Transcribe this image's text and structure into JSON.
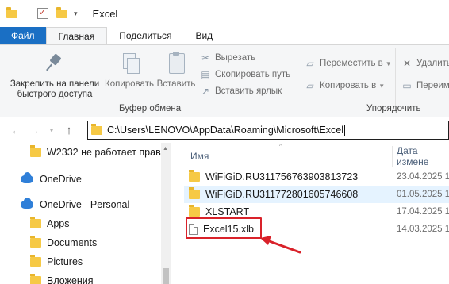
{
  "titlebar": {
    "title": "Excel"
  },
  "ribbon_tabs": [
    {
      "label": "Файл"
    },
    {
      "label": "Главная"
    },
    {
      "label": "Поделиться"
    },
    {
      "label": "Вид"
    }
  ],
  "ribbon": {
    "pin_label_line1": "Закрепить на панели",
    "pin_label_line2": "быстрого доступа",
    "copy_label": "Копировать",
    "paste_label": "Вставить",
    "cut_label": "Вырезать",
    "copy_path_label": "Скопировать путь",
    "paste_shortcut_label": "Вставить ярлык",
    "clipboard_group": "Буфер обмена",
    "move_to_label": "Переместить в",
    "copy_to_label": "Копировать в",
    "organize_group": "Упорядочить",
    "delete_label": "Удалить",
    "rename_label": "Переим"
  },
  "address": {
    "path": "C:\\Users\\LENOVO\\AppData\\Roaming\\Microsoft\\Excel"
  },
  "nav_pane": [
    {
      "label": "W2332 не работает правая",
      "icon": "folder-icon"
    },
    {
      "label": "OneDrive",
      "icon": "onedrive-icon"
    },
    {
      "label": "OneDrive - Personal",
      "icon": "onedrive-icon"
    },
    {
      "label": "Apps",
      "icon": "folder-icon"
    },
    {
      "label": "Documents",
      "icon": "folder-icon"
    },
    {
      "label": "Pictures",
      "icon": "folder-icon"
    },
    {
      "label": "Вложения",
      "icon": "folder-icon"
    }
  ],
  "file_list": {
    "columns": {
      "name": "Имя",
      "date": "Дата измене"
    },
    "rows": [
      {
        "name": "WiFiGiD.RU311756763903813723",
        "date": "23.04.2025 12",
        "type": "folder"
      },
      {
        "name": "WiFiGiD.RU311772801605746608",
        "date": "01.05.2025 1",
        "type": "folder"
      },
      {
        "name": "XLSTART",
        "date": "17.04.2025 12",
        "type": "folder"
      },
      {
        "name": "Excel15.xlb",
        "date": "14.03.2025 1",
        "type": "file"
      }
    ]
  },
  "colors": {
    "file_tab": "#1a6fc4",
    "annotation": "#d9222a",
    "selected_row": "#e5f3ff",
    "folder": "#f6c945"
  }
}
